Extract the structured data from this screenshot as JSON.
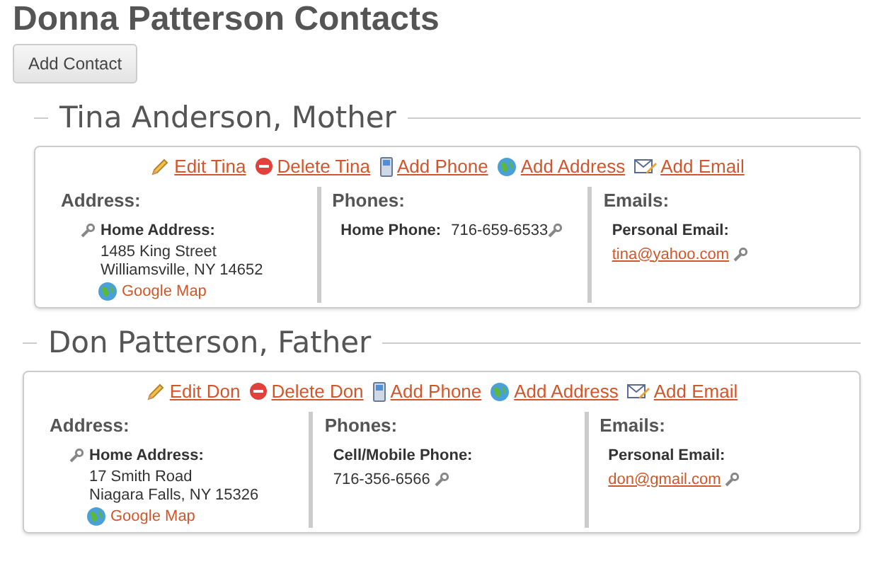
{
  "page_title": "Donna Patterson Contacts",
  "add_button": "Add Contact",
  "contacts": [
    {
      "heading": "Tina Anderson, Mother",
      "actions": [
        {
          "kind": "edit",
          "label": "Edit Tina"
        },
        {
          "kind": "delete",
          "label": "Delete Tina"
        },
        {
          "kind": "phone",
          "label": "Add Phone"
        },
        {
          "kind": "address",
          "label": "Add Address"
        },
        {
          "kind": "email",
          "label": "Add Email"
        }
      ],
      "address": {
        "heading": "Address:",
        "label": "Home Address:",
        "lines": [
          "1485 King Street",
          "Williamsville, NY 14652"
        ],
        "map_link": "Google Map"
      },
      "phones": {
        "heading": "Phones:",
        "items": [
          {
            "kind": "inline",
            "label": "Home Phone:",
            "number": "716-659-6533"
          }
        ]
      },
      "emails": {
        "heading": "Emails:",
        "items": [
          {
            "label": "Personal Email:",
            "address": "tina@yahoo.com"
          }
        ]
      }
    },
    {
      "heading": "Don Patterson, Father",
      "actions": [
        {
          "kind": "edit",
          "label": "Edit Don"
        },
        {
          "kind": "delete",
          "label": "Delete Don"
        },
        {
          "kind": "phone",
          "label": "Add Phone"
        },
        {
          "kind": "address",
          "label": "Add Address"
        },
        {
          "kind": "email",
          "label": "Add Email"
        }
      ],
      "address": {
        "heading": "Address:",
        "label": "Home Address:",
        "lines": [
          "17 Smith Road",
          "Niagara Falls, NY 15326"
        ],
        "map_link": "Google Map"
      },
      "phones": {
        "heading": "Phones:",
        "items": [
          {
            "kind": "stacked",
            "label": "Cell/Mobile Phone:",
            "number": "716-356-6566"
          }
        ]
      },
      "emails": {
        "heading": "Emails:",
        "items": [
          {
            "label": "Personal Email:",
            "address": "don@gmail.com"
          }
        ]
      }
    }
  ]
}
